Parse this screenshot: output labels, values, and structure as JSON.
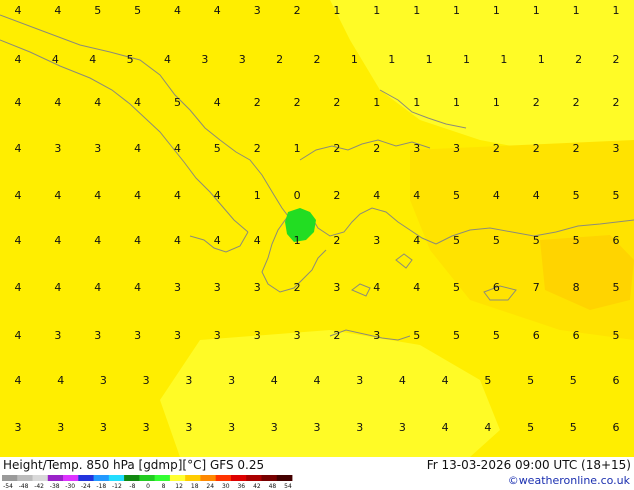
{
  "map": {
    "region": "eastern-mediterranean-balkans",
    "colors": {
      "field_main": "#ffee00",
      "field_warm": "#ffe300",
      "field_cool": "#fffb26",
      "field_hot": "#ffd400",
      "coastline": "#8c8c78",
      "low_cell": "#22dd22"
    },
    "rows": [
      [
        "4",
        "4",
        "5",
        "5",
        "4",
        "4",
        "3",
        "2",
        "1",
        "1",
        "1",
        "1",
        "1",
        "1",
        "1",
        "1"
      ],
      [
        "4",
        "4",
        "4",
        "5",
        "4",
        "3",
        "3",
        "2",
        "2",
        "1",
        "1",
        "1",
        "1",
        "1",
        "1",
        "2",
        "2"
      ],
      [
        "4",
        "4",
        "4",
        "4",
        "5",
        "4",
        "2",
        "2",
        "2",
        "1",
        "1",
        "1",
        "1",
        "2",
        "2",
        "2"
      ],
      [
        "4",
        "3",
        "3",
        "4",
        "4",
        "5",
        "2",
        "1",
        "2",
        "2",
        "3",
        "3",
        "2",
        "2",
        "2",
        "3"
      ],
      [
        "4",
        "4",
        "4",
        "4",
        "4",
        "4",
        "1",
        "0",
        "2",
        "4",
        "4",
        "5",
        "4",
        "4",
        "5",
        "5"
      ],
      [
        "4",
        "4",
        "4",
        "4",
        "4",
        "4",
        "4",
        "1",
        "2",
        "3",
        "4",
        "5",
        "5",
        "5",
        "5",
        "6"
      ],
      [
        "4",
        "4",
        "4",
        "4",
        "3",
        "3",
        "3",
        "2",
        "3",
        "4",
        "4",
        "5",
        "6",
        "7",
        "8",
        "5"
      ],
      [
        "4",
        "3",
        "3",
        "3",
        "3",
        "3",
        "3",
        "3",
        "2",
        "3",
        "5",
        "5",
        "5",
        "6",
        "6",
        "5"
      ],
      [
        "4",
        "4",
        "3",
        "3",
        "3",
        "3",
        "4",
        "4",
        "3",
        "4",
        "4",
        "5",
        "5",
        "5",
        "6"
      ],
      [
        "3",
        "3",
        "3",
        "3",
        "3",
        "3",
        "3",
        "3",
        "3",
        "3",
        "4",
        "4",
        "5",
        "5",
        "6"
      ]
    ]
  },
  "footer": {
    "title": "Height/Temp. 850 hPa [gdmp][°C] GFS 0.25",
    "datetime": "Fr 13-03-2026 09:00 UTC (18+15)",
    "credit": "©weatheronline.co.uk"
  },
  "legend": {
    "ticks": [
      "-54",
      "-48",
      "-42",
      "-38",
      "-30",
      "-24",
      "-18",
      "-12",
      "-8",
      "0",
      "8",
      "12",
      "18",
      "24",
      "30",
      "36",
      "42",
      "48",
      "54"
    ],
    "colors": [
      "#9a9a9a",
      "#bcbcbc",
      "#d9d9d9",
      "#9a22c8",
      "#dd33ff",
      "#2233dd",
      "#2299ff",
      "#22ddff",
      "#118811",
      "#22cc22",
      "#33ff33",
      "#ffff33",
      "#ffcc00",
      "#ff8800",
      "#ff3300",
      "#dd0000",
      "#aa0000",
      "#770000",
      "#440000"
    ]
  }
}
